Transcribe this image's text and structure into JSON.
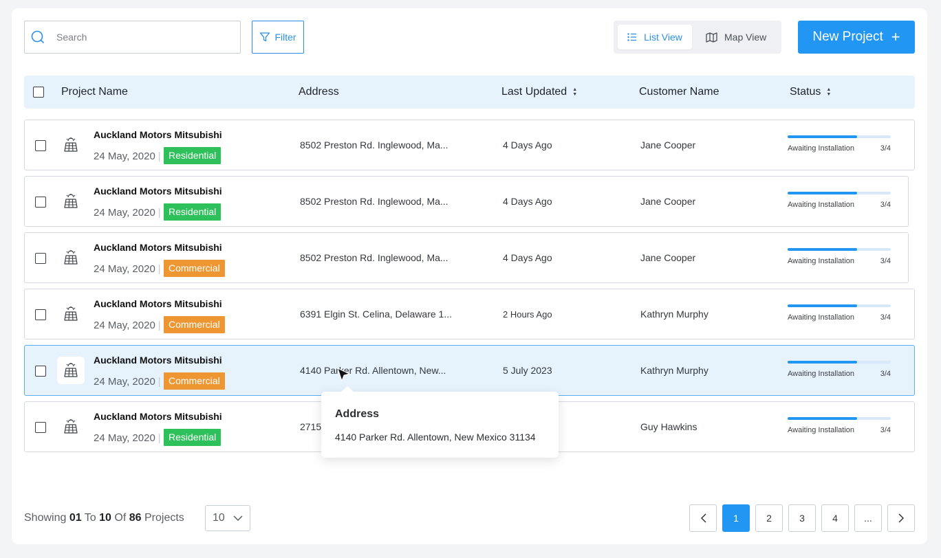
{
  "toolbar": {
    "search_placeholder": "Search",
    "filter_label": "Filter",
    "list_view_label": "List View",
    "map_view_label": "Map View",
    "new_project_label": "New Project",
    "new_project_icon": "+"
  },
  "table": {
    "headers": {
      "project_name": "Project Name",
      "address": "Address",
      "last_updated": "Last Updated",
      "customer_name": "Customer Name",
      "status": "Status"
    },
    "rows": [
      {
        "name": "Auckland Motors Mitsubishi",
        "date": "24 May, 2020",
        "tag": "Residential",
        "tag_type": "res",
        "address": "8502 Preston Rd. Inglewood, Ma...",
        "updated": "4 Days Ago",
        "customer": "Jane Cooper",
        "status_label": "Awaiting Installation",
        "status_count": "3/4",
        "progress": 0.67
      },
      {
        "name": "Auckland Motors Mitsubishi",
        "date": "24 May, 2020",
        "tag": "Residential",
        "tag_type": "res",
        "address": "8502 Preston Rd. Inglewood, Ma...",
        "updated": "4 Days Ago",
        "customer": "Jane Cooper",
        "status_label": "Awaiting Installation",
        "status_count": "3/4",
        "progress": 0.67
      },
      {
        "name": "Auckland Motors Mitsubishi",
        "date": "24 May, 2020",
        "tag": "Commercial",
        "tag_type": "com",
        "address": "8502 Preston Rd. Inglewood, Ma...",
        "updated": "4 Days Ago",
        "customer": "Jane Cooper",
        "status_label": "Awaiting Installation",
        "status_count": "3/4",
        "progress": 0.67
      },
      {
        "name": "Auckland Motors Mitsubishi",
        "date": "24 May, 2020",
        "tag": "Commercial",
        "tag_type": "com",
        "address": "6391 Elgin St. Celina, Delaware 1...",
        "updated": "2 Hours Ago",
        "customer": "Kathryn Murphy",
        "status_label": "Awaiting Installation",
        "status_count": "3/4",
        "progress": 0.67
      },
      {
        "name": "Auckland Motors Mitsubishi",
        "date": "24 May, 2020",
        "tag": "Commercial",
        "tag_type": "com",
        "address": "4140 Parker Rd. Allentown, New...",
        "updated": "5 July 2023",
        "customer": "Kathryn Murphy",
        "status_label": "Awaiting Installation",
        "status_count": "3/4",
        "progress": 0.67,
        "selected": true
      },
      {
        "name": "Auckland Motors Mitsubishi",
        "date": "24 May, 2020",
        "tag": "Residential",
        "tag_type": "res",
        "address": "2715",
        "updated": "",
        "customer": "Guy Hawkins",
        "status_label": "Awaiting Installation",
        "status_count": "3/4",
        "progress": 0.67
      }
    ]
  },
  "tooltip": {
    "title": "Address",
    "body": "4140 Parker Rd. Allentown, New Mexico 31134"
  },
  "footer": {
    "showing": "Showing",
    "from": "01",
    "to_word": "To",
    "to": "10",
    "of_word": "Of",
    "total": "86",
    "projects_word": "Projects",
    "per_page": "10",
    "pages": [
      "1",
      "2",
      "3",
      "4",
      "..."
    ],
    "active_page": "1"
  },
  "colors": {
    "accent": "#2196f3",
    "residential": "#2ec05a",
    "commercial": "#ee9632",
    "header_bg": "#e6f2fc"
  }
}
